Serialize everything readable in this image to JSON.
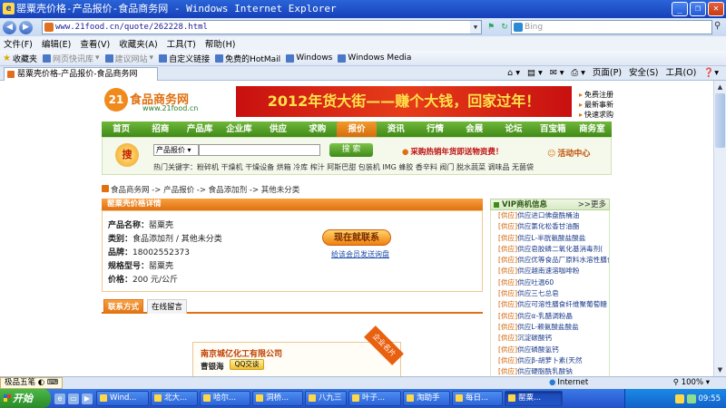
{
  "window": {
    "title": "罂粟壳价格-产品报价-食品商务网 - Windows Internet Explorer"
  },
  "address": {
    "url": "www.21food.cn/quote/262228.html",
    "search_placeholder": "Bing"
  },
  "menu": [
    "文件(F)",
    "编辑(E)",
    "查看(V)",
    "收藏夹(A)",
    "工具(T)",
    "帮助(H)"
  ],
  "favorites_bar": {
    "label": "收藏夹",
    "items": [
      "网页快讯库",
      "建议网站",
      "自定义链接",
      "免费的HotMail",
      "Windows",
      "Windows Media"
    ]
  },
  "tab": {
    "title": "罂粟壳价格-产品报价-食品商务网"
  },
  "command_bar": [
    "页面(P)",
    "安全(S)",
    "工具(O)"
  ],
  "site": {
    "logo_badge": "21",
    "logo_name": "食品商务网",
    "logo_domain": "www.21food.cn",
    "banner_text": "2012年货大街——赚个大钱，回家过年！",
    "quick_links": [
      "免费注册",
      "最新事新",
      "快速求购"
    ],
    "nav": [
      "首页",
      "招商",
      "产品库",
      "企业库",
      "供应",
      "求购",
      "报价",
      "资讯",
      "行情",
      "会展",
      "论坛",
      "百宝箱",
      "商务室"
    ],
    "nav_active_index": 6,
    "search": {
      "icon_text": "搜",
      "select_value": "产品报价",
      "button": "搜 索",
      "promo": "采购热销年货即送物资费！",
      "hot_keywords": "热门关键字：粉碎机 干燥机 干燥设备 烘箱 冷库 榨汁 阿斯巴甜 包装机 IMG 蜂胶 香辛料 阀门 脱水蔬菜 调味品 无菌袋",
      "activity": "活动中心"
    },
    "breadcrumb": "食品商务网 -> 产品报价 -> 食品添加剂 -> 其他未分类",
    "detail": {
      "header": "罂粟壳价格详情",
      "name_label": "产品名称：",
      "name_value": "罂粟壳",
      "category_label": "类别：",
      "category_value": "食品添加剂 / 其他未分类",
      "brand_label": "品牌：",
      "brand_value": "18002552373",
      "spec_label": "规格型号：",
      "spec_value": "罂粟壳",
      "price_label": "价格：",
      "price_value": "200 元/公斤",
      "call_button": "现在就联系",
      "send_link": "给该会员发送询盘"
    },
    "tabs": [
      "联系方式",
      "在线留言"
    ],
    "company": {
      "name": "南京城亿化工有限公司",
      "contact": "曹银海",
      "qq_button": "QQ交谈",
      "ribbon": "企业名片"
    },
    "vip": {
      "title": "VIP商机信息",
      "more": ">>更多",
      "items": [
        {
          "tag": "[供应]",
          "text": "供应进口佛盘酰桶油"
        },
        {
          "tag": "[供应]",
          "text": "供应氯化松香甘油酯"
        },
        {
          "tag": "[供应]",
          "text": "供应L-半胱氨酸盐酸盐"
        },
        {
          "tag": "[供应]",
          "text": "供应皂胶磷二氧化基消毒剂("
        },
        {
          "tag": "[供应]",
          "text": "供应优等食品厂原料水溶性膳食"
        },
        {
          "tag": "[供应]",
          "text": "供应越南速溶咖啡粉"
        },
        {
          "tag": "[供应]",
          "text": "供应吐温60"
        },
        {
          "tag": "[供应]",
          "text": "供应三七总皂"
        },
        {
          "tag": "[供应]",
          "text": "供应可溶性膳食纤维聚葡萄糖"
        },
        {
          "tag": "[供应]",
          "text": "供应α-乳醋调粉晶"
        },
        {
          "tag": "[供应]",
          "text": "供应L-赖氨酸盐酸盐"
        },
        {
          "tag": "[供应]",
          "text": "沉淀碳酸钙"
        },
        {
          "tag": "[供应]",
          "text": "供应磷酸氢钙"
        },
        {
          "tag": "[供应]",
          "text": "供应β-胡萝卜素(天然"
        },
        {
          "tag": "[供应]",
          "text": "供应硬脂酰乳酸钠"
        }
      ]
    }
  },
  "statusbar": {
    "ime": "极品五笔",
    "zone": "Internet",
    "zoom": "100%"
  },
  "taskbar": {
    "start": "开始",
    "tasks": [
      "Wind...",
      "北大...",
      "哈尔...",
      "洞桥...",
      "八九三",
      "叶子...",
      "淘助手",
      "每日...",
      "罂粟..."
    ],
    "active_index": 8,
    "clock": "09:55"
  }
}
